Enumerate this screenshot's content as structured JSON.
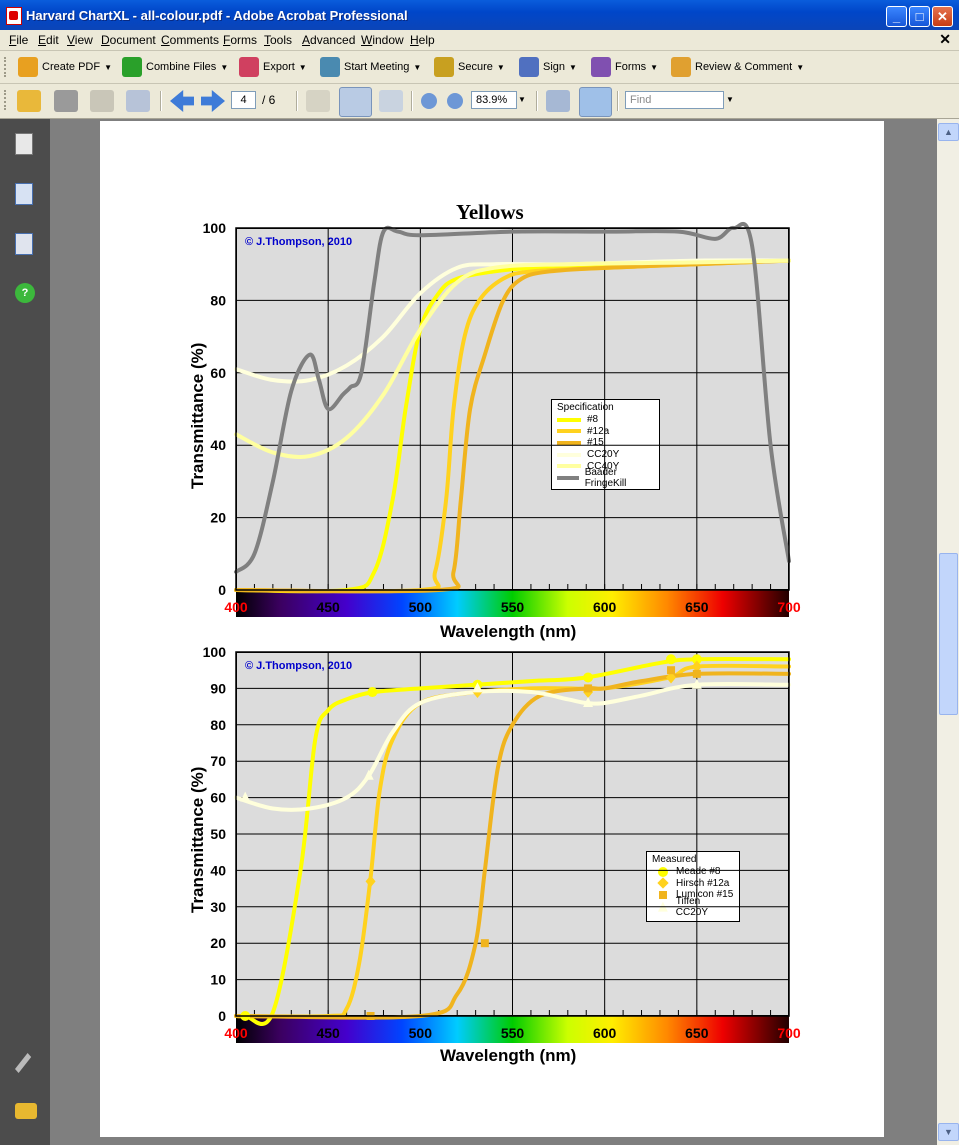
{
  "window": {
    "title": "Harvard ChartXL - all-colour.pdf - Adobe Acrobat Professional",
    "controls": [
      "_",
      "□",
      "✕"
    ]
  },
  "menubar": {
    "items": [
      "File",
      "Edit",
      "View",
      "Document",
      "Comments",
      "Forms",
      "Tools",
      "Advanced",
      "Window",
      "Help"
    ],
    "close": "✕"
  },
  "tasks_toolbar": {
    "items": [
      {
        "label": "Create PDF",
        "icon": "create-pdf-icon",
        "color": "#e8a020"
      },
      {
        "label": "Combine Files",
        "icon": "combine-files-icon",
        "color": "#2aa02a"
      },
      {
        "label": "Export",
        "icon": "export-icon",
        "color": "#d04060"
      },
      {
        "label": "Start Meeting",
        "icon": "meeting-icon",
        "color": "#4a8ab0"
      },
      {
        "label": "Secure",
        "icon": "lock-icon",
        "color": "#c8a020"
      },
      {
        "label": "Sign",
        "icon": "pen-icon",
        "color": "#5070c0"
      },
      {
        "label": "Forms",
        "icon": "forms-icon",
        "color": "#8050b0"
      },
      {
        "label": "Review & Comment",
        "icon": "review-comment-icon",
        "color": "#e0a030"
      }
    ]
  },
  "nav_toolbar": {
    "page_current": "4",
    "page_total": "/ 6",
    "zoom": "83.9%",
    "find_placeholder": "Find"
  },
  "document": {
    "title": "Yellows",
    "charts_shared": {
      "copyright": "© J.Thompson, 2010",
      "ylabel": "Transmittance (%)",
      "xlabel": "Wavelength (nm)",
      "x_ticks": [
        "400",
        "450",
        "500",
        "550",
        "600",
        "650",
        "700"
      ]
    }
  },
  "chart_data": [
    {
      "type": "line",
      "title": "Yellows",
      "xlabel": "Wavelength (nm)",
      "ylabel": "Transmittance (%)",
      "xlim": [
        400,
        700
      ],
      "ylim": [
        0,
        100
      ],
      "y_ticks": [
        "0",
        "20",
        "40",
        "60",
        "80",
        "100"
      ],
      "grid": true,
      "legend": {
        "title": "Specification",
        "placement": "center-right"
      },
      "series": [
        {
          "name": "#8",
          "color": "#ffff00",
          "x": [
            400,
            460,
            475,
            485,
            492,
            500,
            510,
            520,
            540,
            560,
            600,
            650,
            700
          ],
          "y": [
            0,
            0,
            5,
            25,
            50,
            72,
            82,
            86,
            88,
            89,
            90,
            90.5,
            91
          ]
        },
        {
          "name": "#12a",
          "color": "#ffd21e",
          "x": [
            400,
            500,
            508,
            514,
            518,
            524,
            532,
            545,
            560,
            600,
            650,
            700
          ],
          "y": [
            0,
            0,
            5,
            25,
            50,
            70,
            80,
            86,
            88,
            89,
            90,
            91
          ]
        },
        {
          "name": "#15",
          "color": "#f0b41e",
          "x": [
            400,
            510,
            518,
            522,
            527,
            535,
            545,
            555,
            570,
            600,
            650,
            700
          ],
          "y": [
            0,
            0,
            5,
            25,
            50,
            65,
            80,
            86,
            88,
            89,
            90,
            91
          ]
        },
        {
          "name": "CC20Y",
          "color": "#ffffdc",
          "x": [
            400,
            420,
            440,
            460,
            480,
            500,
            520,
            540,
            580,
            650,
            700
          ],
          "y": [
            61,
            58,
            58,
            62,
            70,
            82,
            89,
            90,
            90,
            91,
            91
          ]
        },
        {
          "name": "CC40Y",
          "color": "#ffffa0",
          "x": [
            400,
            420,
            440,
            460,
            480,
            500,
            520,
            540,
            580,
            650,
            700
          ],
          "y": [
            43,
            38,
            37,
            42,
            54,
            72,
            85,
            89,
            90,
            90.5,
            91
          ]
        },
        {
          "name": "Baader FringeKill",
          "color": "#808080",
          "x": [
            400,
            410,
            420,
            430,
            440,
            445,
            450,
            458,
            462,
            468,
            475,
            480,
            488,
            500,
            550,
            600,
            640,
            660,
            670,
            680,
            690,
            700
          ],
          "y": [
            5,
            10,
            30,
            55,
            65,
            58,
            50,
            54,
            56,
            60,
            85,
            99,
            99,
            98,
            99,
            99,
            99,
            97,
            100,
            95,
            40,
            8
          ]
        }
      ]
    },
    {
      "type": "line",
      "title": "",
      "xlabel": "Wavelength (nm)",
      "ylabel": "Transmittance (%)",
      "xlim": [
        400,
        700
      ],
      "ylim": [
        0,
        100
      ],
      "y_ticks": [
        "0",
        "10",
        "20",
        "30",
        "40",
        "50",
        "60",
        "70",
        "80",
        "90",
        "100"
      ],
      "grid": true,
      "legend": {
        "title": "Measured",
        "placement": "center-right"
      },
      "series": [
        {
          "name": "Meade #8",
          "color": "#ffff00",
          "marker": "circle",
          "x": [
            400,
            405,
            420,
            435,
            443,
            450,
            460,
            475,
            500,
            530,
            560,
            590,
            630,
            650,
            700
          ],
          "y": [
            0,
            0,
            1,
            40,
            76,
            84,
            87,
            89,
            90,
            91,
            92,
            93,
            97,
            98,
            98
          ]
        },
        {
          "name": "Hirsch #12a",
          "color": "#ffd21e",
          "marker": "diamond",
          "x": [
            400,
            450,
            460,
            467,
            473,
            478,
            485,
            500,
            530,
            560,
            580,
            600,
            635,
            650,
            700
          ],
          "y": [
            0,
            0,
            2,
            15,
            38,
            62,
            76,
            86,
            89,
            90,
            90,
            90,
            93,
            96,
            96
          ]
        },
        {
          "name": "Lumicon #15",
          "color": "#f0b41e",
          "marker": "square",
          "x": [
            400,
            500,
            520,
            530,
            535,
            542,
            550,
            565,
            590,
            600,
            620,
            650,
            700
          ],
          "y": [
            0,
            0,
            6,
            20,
            40,
            68,
            80,
            88,
            90,
            90,
            92,
            94,
            94
          ]
        },
        {
          "name": "Tiffen CC20Y",
          "color": "#ffffdc",
          "marker": "triangle",
          "x": [
            400,
            420,
            440,
            460,
            472,
            485,
            500,
            530,
            560,
            580,
            590,
            600,
            620,
            650,
            700
          ],
          "y": [
            60,
            57,
            57,
            60,
            66,
            78,
            86,
            89,
            89,
            87,
            86,
            86,
            88,
            91,
            91
          ]
        }
      ],
      "markers": {
        "Meade #8": [
          [
            405,
            0
          ],
          [
            474,
            89
          ],
          [
            531,
            91
          ],
          [
            591,
            93
          ],
          [
            636,
            98
          ],
          [
            650,
            98
          ]
        ],
        "Hirsch #12a": [
          [
            473,
            37
          ],
          [
            531,
            89
          ],
          [
            591,
            89
          ],
          [
            636,
            93
          ],
          [
            650,
            96
          ]
        ],
        "Lumicon #15": [
          [
            473,
            0
          ],
          [
            535,
            20
          ],
          [
            591,
            90
          ],
          [
            636,
            95
          ],
          [
            650,
            94
          ]
        ],
        "Tiffen CC20Y": [
          [
            405,
            60
          ],
          [
            472,
            66
          ],
          [
            531,
            90
          ],
          [
            591,
            86
          ],
          [
            650,
            91
          ]
        ]
      }
    }
  ]
}
